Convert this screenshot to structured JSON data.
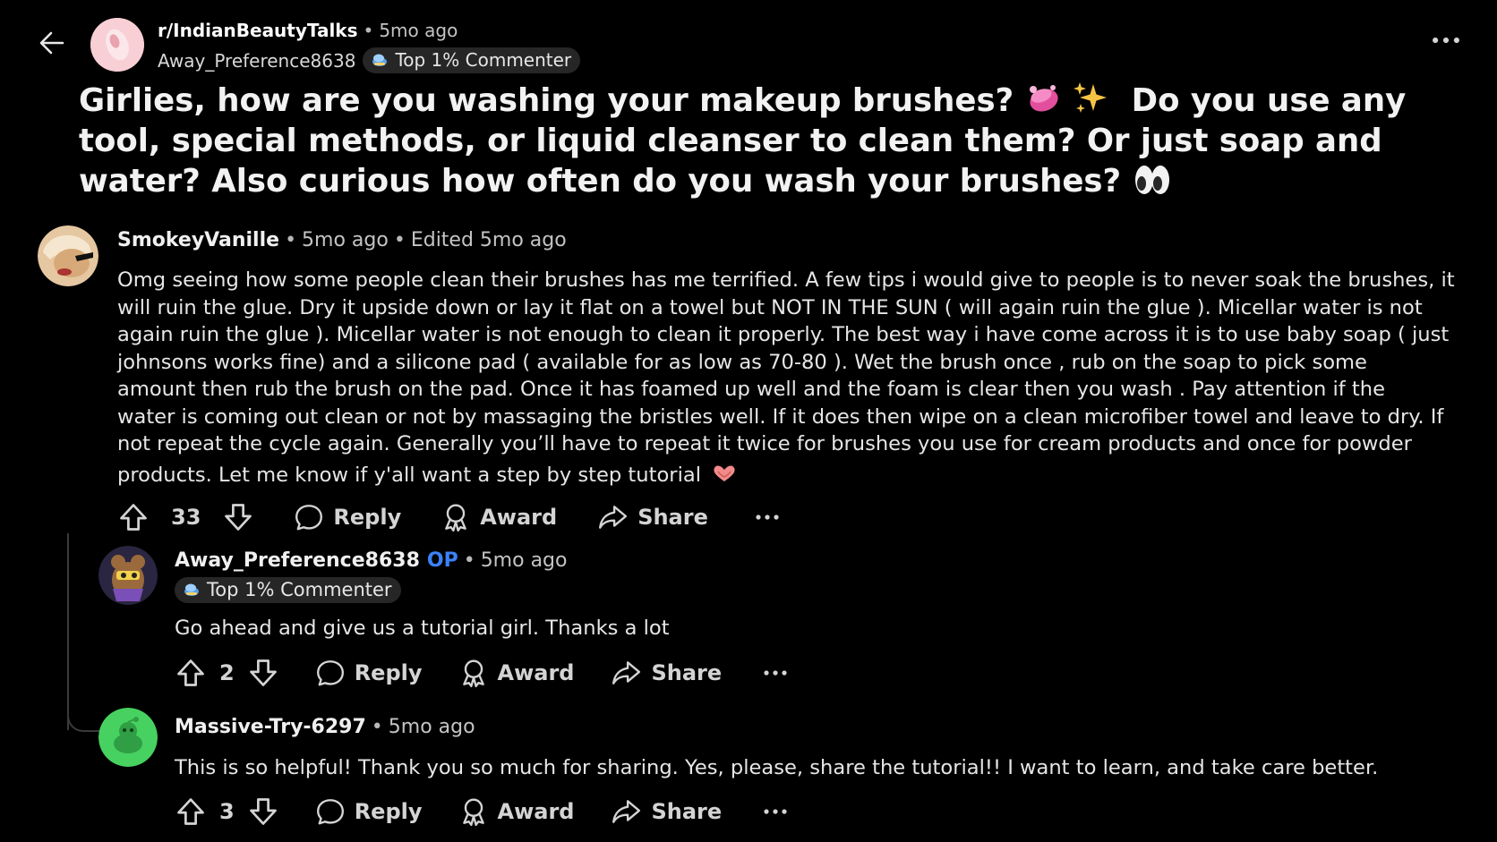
{
  "header": {
    "subreddit": "r/IndianBeautyTalks",
    "post_age": "5mo ago",
    "author": "Away_Preference8638",
    "flair": "Top 1% Commenter"
  },
  "post": {
    "title_part1": "Girlies, how are you washing your makeup brushes?",
    "title_part2": "Do you use any tool, special methods, or liquid cleanser to clean them? Or just soap and water? Also curious how often do you wash your brushes?",
    "emojis": [
      "soap-bubbles-emoji",
      "sparkles-emoji",
      "eyes-emoji"
    ]
  },
  "comments": [
    {
      "user": "SmokeyVanille",
      "age": "5mo ago",
      "edited": "Edited 5mo ago",
      "lines": [
        "Omg seeing how some people clean their brushes has me terrified. A few tips i would give to people is to never soak the brushes, it",
        "will ruin the glue. Dry it upside down or lay it flat on a towel but NOT IN THE SUN ( will again ruin the glue ). Micellar water is not",
        "again ruin the glue ). Micellar water is not enough to clean it properly. The best way i have come across it is to use baby soap ( just",
        "johnsons works fine) and a silicone pad ( available for as low as 70-80 ). Wet the brush once , rub on the soap to pick some",
        "amount then rub the brush on the pad. Once it has foamed up well and the foam is clear then you wash . Pay attention if the",
        "water is coming out clean or not by massaging the bristles well. If it does then wipe on a clean microfiber towel and leave to dry. If",
        "not repeat the cycle again. Generally you’ll have to repeat it twice for brushes you use for cream products and once for powder",
        "products. Let me know if y'all want a step by step tutorial"
      ],
      "votes": "33",
      "actions": {
        "reply": "Reply",
        "award": "Award",
        "share": "Share"
      }
    },
    {
      "user": "Away_Preference8638",
      "op_label": "OP",
      "age": "5mo ago",
      "flair": "Top 1% Commenter",
      "body": "Go ahead and give us a tutorial girl. Thanks a lot",
      "votes": "2",
      "actions": {
        "reply": "Reply",
        "award": "Award",
        "share": "Share"
      }
    },
    {
      "user": "Massive-Try-6297",
      "age": "5mo ago",
      "body": "This is so helpful! Thank you so much for sharing. Yes, please, share the tutorial!! I want to learn, and take care better.",
      "votes": "3",
      "actions": {
        "reply": "Reply",
        "award": "Award",
        "share": "Share"
      }
    }
  ],
  "colors": {
    "background": "#000000",
    "op_blue": "#3b82f6",
    "flair_bg": "#262626"
  }
}
